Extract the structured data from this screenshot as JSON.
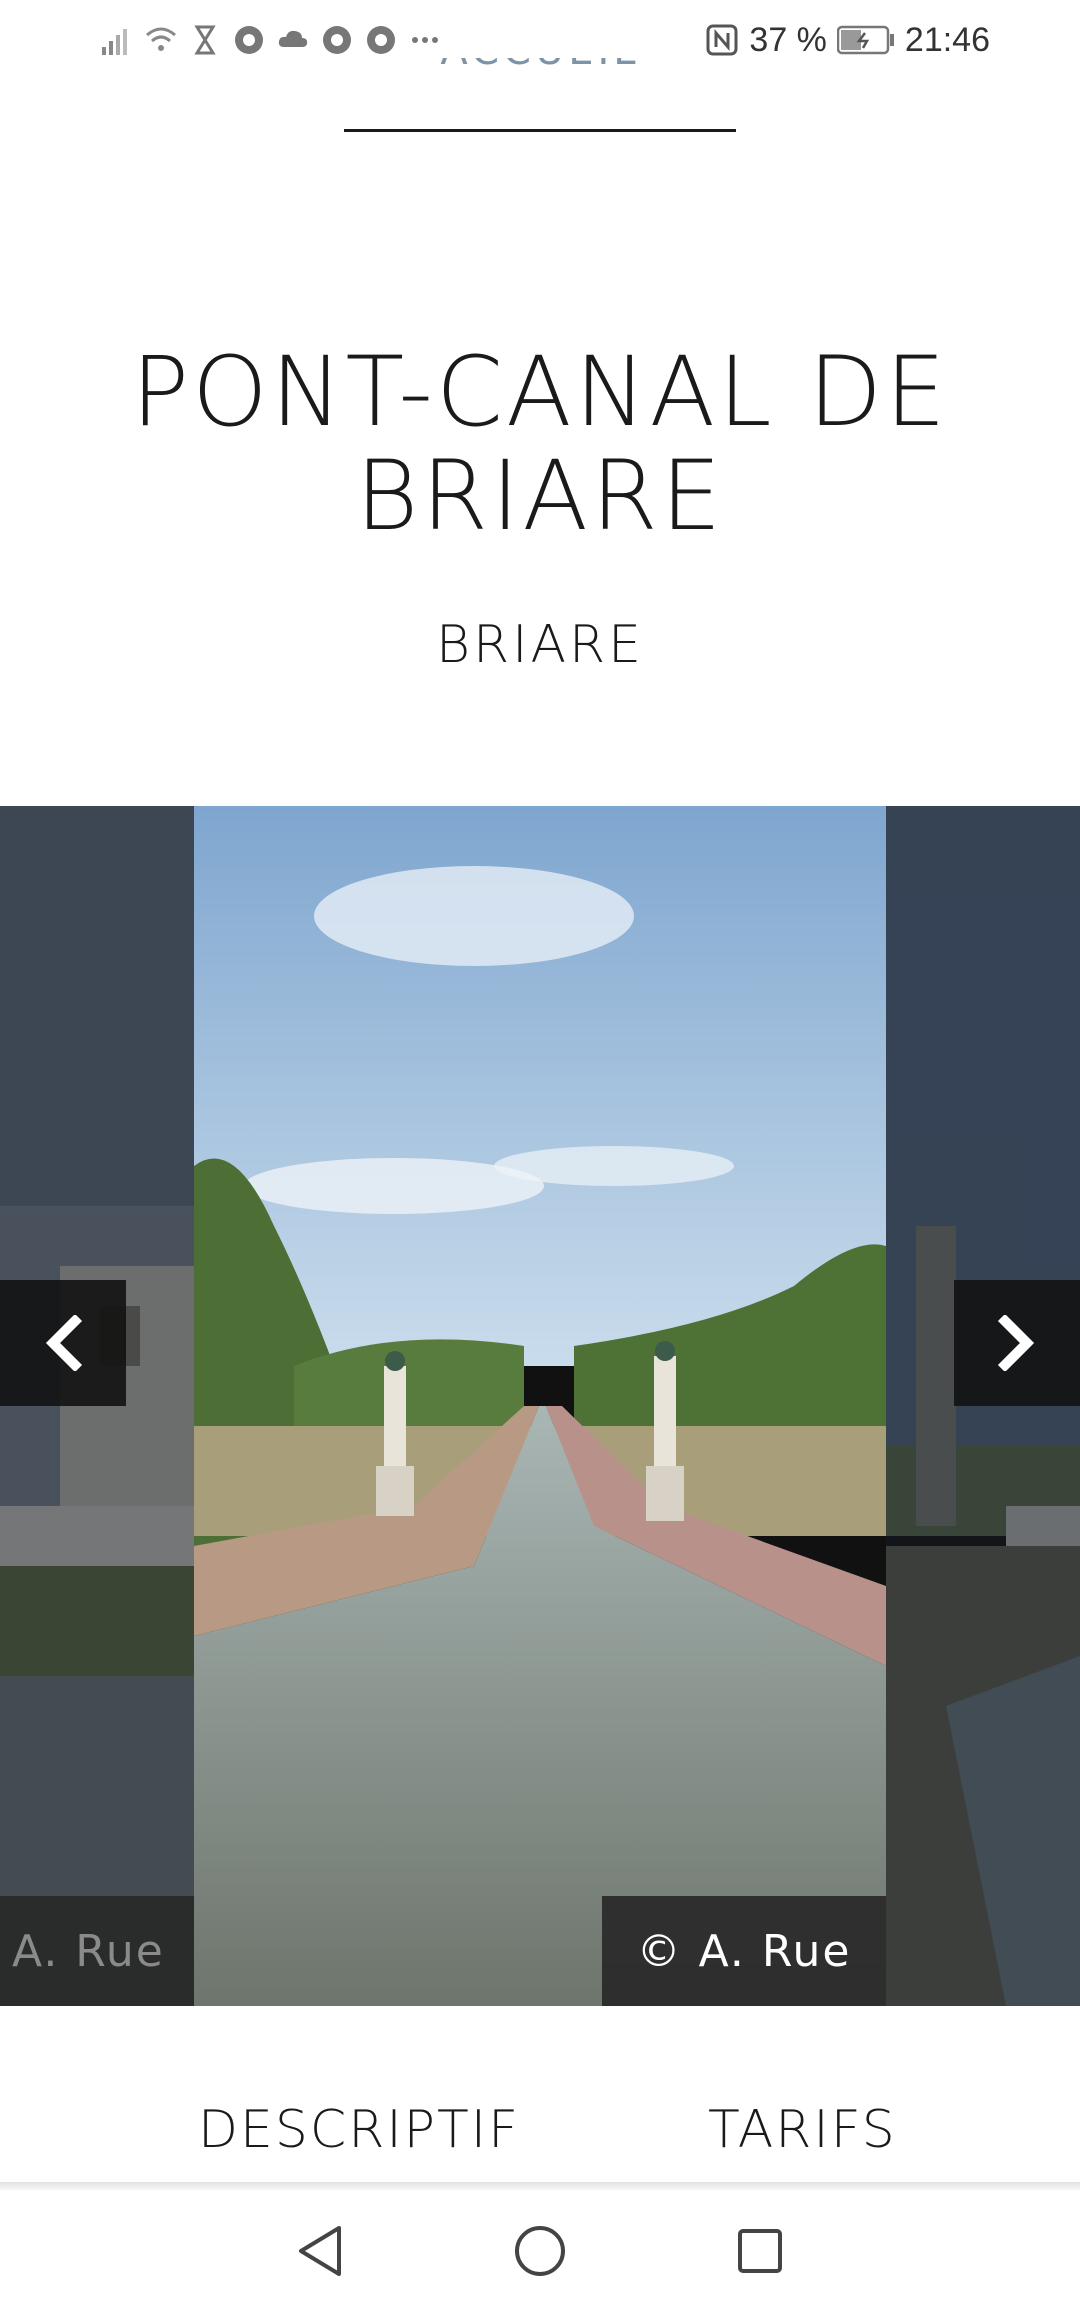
{
  "status_bar": {
    "battery_percent": "37 %",
    "time": "21:46",
    "icons": [
      "signal-icon",
      "wifi-icon",
      "hourglass-icon",
      "chrome-icon",
      "cloud-icon",
      "chrome-icon",
      "chrome-icon",
      "more-icon",
      "nfc-icon",
      "battery-icon"
    ]
  },
  "nav": {
    "active_label": "ACCUEIL"
  },
  "heading": {
    "title": "PONT-CANAL DE BRIARE",
    "location": "BRIARE"
  },
  "carousel": {
    "credit_center": "© A. Rue",
    "credit_left": "A. Rue",
    "prev_icon": "chevron-left-icon",
    "next_icon": "chevron-right-icon"
  },
  "tabs": [
    {
      "label": "DESCRIPTIF"
    },
    {
      "label": "TARIFS"
    }
  ],
  "system_nav": {
    "icons": [
      "back-icon",
      "home-icon",
      "recents-icon"
    ]
  }
}
